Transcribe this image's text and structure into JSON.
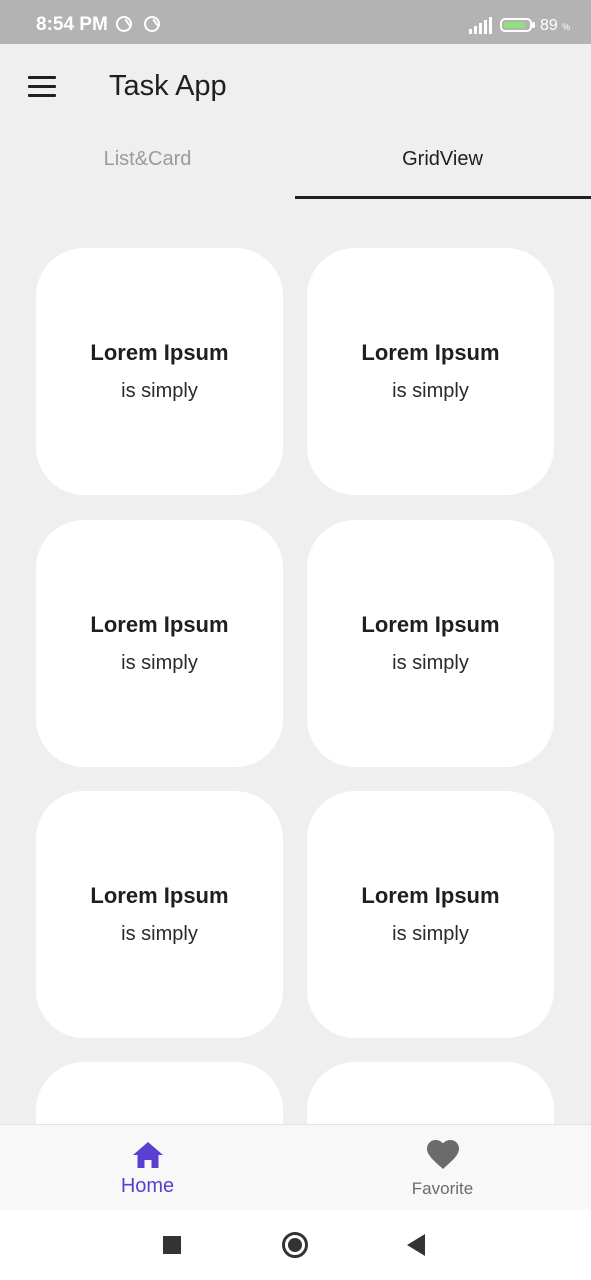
{
  "status_bar": {
    "time": "8:54 PM",
    "battery_percent": "89",
    "battery_unit": "%",
    "battery_level": 0.89,
    "icons": [
      "sync-icon",
      "sync-icon",
      "signal-icon",
      "battery-charging-icon"
    ]
  },
  "app_bar": {
    "title": "Task App",
    "menu_icon": "hamburger-menu-icon"
  },
  "tabs": [
    {
      "label": "List&Card",
      "selected": false
    },
    {
      "label": "GridView",
      "selected": true
    }
  ],
  "grid": {
    "cards": [
      {
        "title": "Lorem Ipsum",
        "subtitle": "is simply"
      },
      {
        "title": "Lorem Ipsum",
        "subtitle": "is simply"
      },
      {
        "title": "Lorem Ipsum",
        "subtitle": "is simply"
      },
      {
        "title": "Lorem Ipsum",
        "subtitle": "is simply"
      },
      {
        "title": "Lorem Ipsum",
        "subtitle": "is simply"
      },
      {
        "title": "Lorem Ipsum",
        "subtitle": "is simply"
      },
      {
        "title": "",
        "subtitle": ""
      },
      {
        "title": "",
        "subtitle": ""
      }
    ]
  },
  "bottom_nav": {
    "items": [
      {
        "label": "Home",
        "icon": "home-icon",
        "selected": true
      },
      {
        "label": "Favorite",
        "icon": "heart-icon",
        "selected": false
      }
    ]
  },
  "colors": {
    "accent": "#5a3fd1",
    "background": "#efefef",
    "card": "#ffffff",
    "status_bar": "#b3b3b3"
  },
  "system_nav": {
    "icons": [
      "recent-apps-icon",
      "home-circle-icon",
      "back-icon"
    ]
  }
}
